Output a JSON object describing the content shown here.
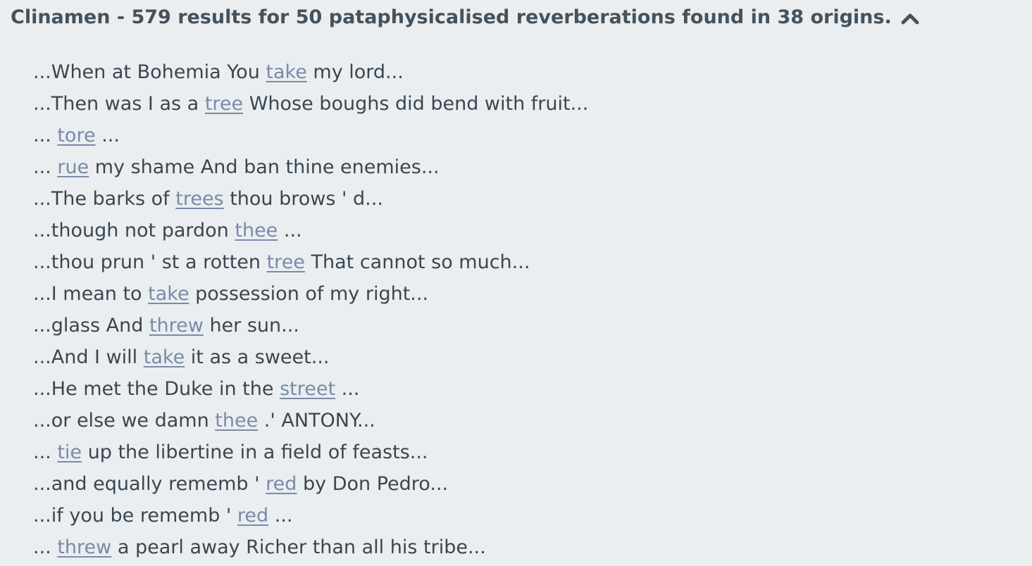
{
  "header": {
    "title": "Clinamen - 579 results for 50 pataphysicalised reverberations found in 38 origins.",
    "toggle_icon": "chevron-up-icon",
    "text_color": "#44525d"
  },
  "colors": {
    "background": "#eaeef1",
    "text": "#3a4650",
    "link": "#7b8aa8"
  },
  "results": [
    {
      "before": "...When at Bohemia You ",
      "keyword": "take",
      "after": " my lord..."
    },
    {
      "before": "...Then was I as a ",
      "keyword": "tree",
      "after": " Whose boughs did bend with fruit..."
    },
    {
      "before": "... ",
      "keyword": "tore",
      "after": " ..."
    },
    {
      "before": "... ",
      "keyword": "rue",
      "after": " my shame And ban thine enemies..."
    },
    {
      "before": "...The barks of ",
      "keyword": "trees",
      "after": " thou brows ' d..."
    },
    {
      "before": "...though not pardon ",
      "keyword": "thee",
      "after": " ..."
    },
    {
      "before": "...thou prun ' st a rotten ",
      "keyword": "tree",
      "after": " That cannot so much..."
    },
    {
      "before": "...I mean to ",
      "keyword": "take",
      "after": " possession of my right..."
    },
    {
      "before": "...glass And ",
      "keyword": "threw",
      "after": " her sun..."
    },
    {
      "before": "...And I will ",
      "keyword": "take",
      "after": " it as a sweet..."
    },
    {
      "before": "...He met the Duke in the ",
      "keyword": "street",
      "after": " ..."
    },
    {
      "before": "...or else we damn ",
      "keyword": "thee",
      "after": " .' ANTONY..."
    },
    {
      "before": "... ",
      "keyword": "tie",
      "after": " up the libertine in a field of feasts..."
    },
    {
      "before": "...and equally rememb ' ",
      "keyword": "red",
      "after": " by Don Pedro..."
    },
    {
      "before": "...if you be rememb ' ",
      "keyword": "red",
      "after": " ..."
    },
    {
      "before": "... ",
      "keyword": "threw",
      "after": " a pearl away Richer than all his tribe..."
    }
  ]
}
